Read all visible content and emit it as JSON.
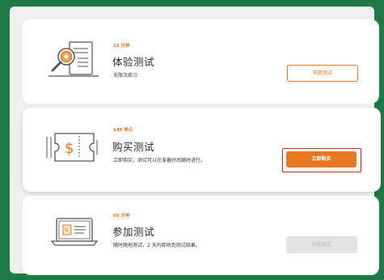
{
  "options": [
    {
      "meta": "15 分钟",
      "title": "体验测试",
      "desc": "无限次练习",
      "button": "样题测试",
      "icon": "magnifier-document-icon"
    },
    {
      "meta": "$49 美元",
      "title": "购买测试",
      "desc": "立即购买，测试可以在准备好后随时进行。",
      "button": "立即购买",
      "icon": "dollar-ticket-icon"
    },
    {
      "meta": "60 分钟",
      "title": "参加测试",
      "desc": "随时随地测试，2 天内即收到测试结果。",
      "button": "开始测试",
      "icon": "laptop-icon"
    }
  ],
  "colors": {
    "accent": "#e87722",
    "highlight_border": "#d11f1f",
    "background": "#1c7a45",
    "disabled": "#e3e3e3"
  }
}
